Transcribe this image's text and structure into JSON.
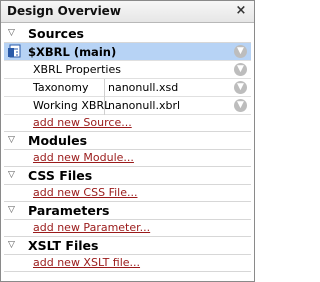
{
  "window": {
    "title": "Design Overview",
    "close_glyph": "×"
  },
  "sections": {
    "sources": {
      "label": "Sources",
      "main_item": "$XBRL (main)",
      "rows": [
        {
          "label": "XBRL Properties",
          "value": ""
        },
        {
          "label": "Taxonomy",
          "value": "nanonull.xsd"
        },
        {
          "label": "Working XBRL",
          "value": "nanonull.xbrl"
        }
      ],
      "add_link": "add new Source..."
    },
    "modules": {
      "label": "Modules",
      "add_link": "add new Module..."
    },
    "css_files": {
      "label": "CSS Files",
      "add_link": "add new CSS File..."
    },
    "parameters": {
      "label": "Parameters",
      "add_link": "add new Parameter..."
    },
    "xslt_files": {
      "label": "XSLT Files",
      "add_link": "add new XSLT file..."
    }
  },
  "icons": {
    "collapse": "triangle-down-icon",
    "file": "xml-file-icon",
    "options": "options-circle-icon"
  },
  "colors": {
    "selected_row": "#b7d3f5",
    "link": "#9a1a1a"
  }
}
